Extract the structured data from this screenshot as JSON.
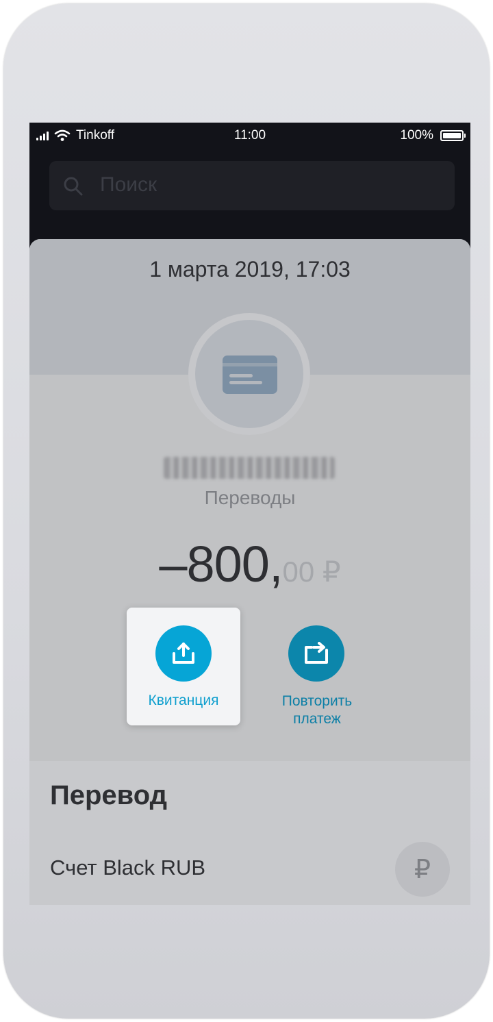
{
  "status_bar": {
    "carrier": "Tinkoff",
    "time": "11:00",
    "battery": "100%"
  },
  "search": {
    "placeholder": "Поиск"
  },
  "operation": {
    "date": "1 марта 2019, 17:03",
    "category": "Переводы",
    "amount_main": "–800,",
    "amount_cents": "00 ₽",
    "icon": "credit-card-icon"
  },
  "actions": {
    "receipt_label": "Квитанция",
    "repeat_label_line1": "Повторить",
    "repeat_label_line2": "платеж"
  },
  "details": {
    "title": "Перевод",
    "account": "Счет Black RUB",
    "currency_symbol": "₽"
  },
  "colors": {
    "accent": "#06a5d6",
    "accent_dark": "#0c86ab"
  }
}
